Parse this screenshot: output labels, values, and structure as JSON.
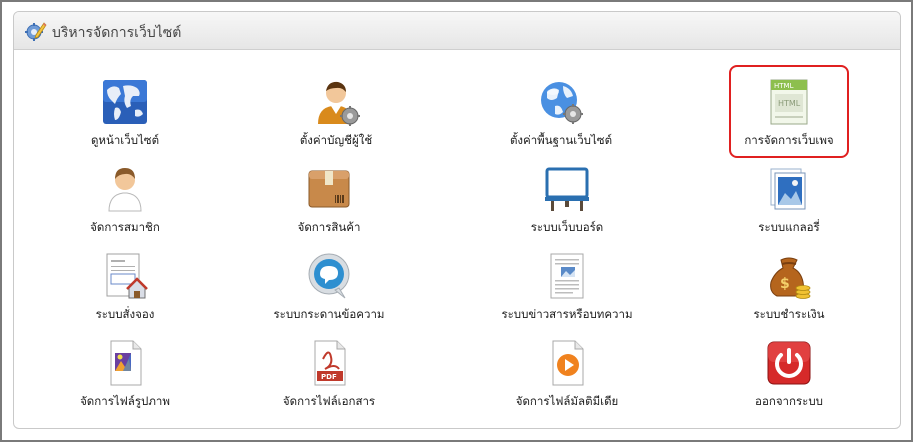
{
  "panel": {
    "title": "บริหารจัดการเว็บไซต์",
    "icon": "gear-pencil-icon"
  },
  "menu": [
    {
      "label": "ดูหน้าเว็บไซต์",
      "icon": "world-map-icon"
    },
    {
      "label": "ตั้งค่าบัญชีผู้ใช้",
      "icon": "user-settings-icon"
    },
    {
      "label": "ตั้งค่าพื้นฐานเว็บไซต์",
      "icon": "globe-settings-icon"
    },
    {
      "label": "การจัดการเว็บเพจ",
      "icon": "html-page-icon",
      "selected": true
    },
    {
      "label": "จัดการสมาชิก",
      "icon": "member-icon"
    },
    {
      "label": "จัดการสินค้า",
      "icon": "product-box-icon"
    },
    {
      "label": "ระบบเว็บบอร์ด",
      "icon": "webboard-icon"
    },
    {
      "label": "ระบบแกลอรี่",
      "icon": "gallery-icon"
    },
    {
      "label": "ระบบสั่งจอง",
      "icon": "booking-form-icon"
    },
    {
      "label": "ระบบกระดานข้อความ",
      "icon": "speech-bubble-icon"
    },
    {
      "label": "ระบบข่าวสารหรือบทความ",
      "icon": "news-article-icon"
    },
    {
      "label": "ระบบชำระเงิน",
      "icon": "money-bag-icon"
    },
    {
      "label": "จัดการไฟล์รูปภาพ",
      "icon": "image-file-icon"
    },
    {
      "label": "จัดการไฟล์เอกสาร",
      "icon": "pdf-file-icon"
    },
    {
      "label": "จัดการไฟล์มัลติมีเดีย",
      "icon": "media-file-icon"
    },
    {
      "label": "ออกจากระบบ",
      "icon": "power-icon"
    }
  ],
  "colors": {
    "highlight": "#e02020",
    "header_text": "#444444"
  }
}
